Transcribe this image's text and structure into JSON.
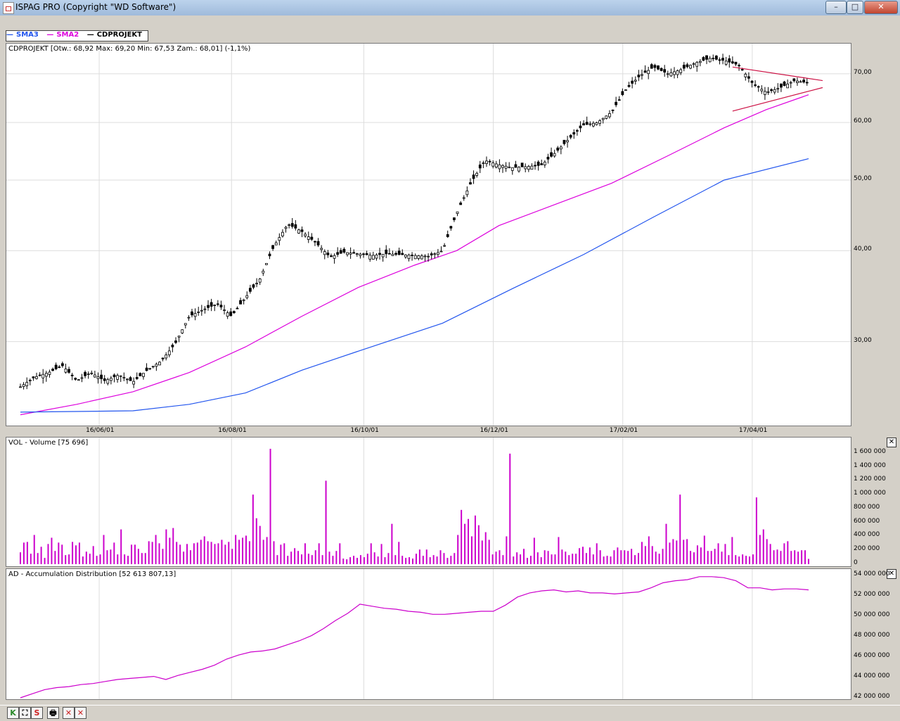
{
  "window": {
    "title": "ISPAG PRO (Copyright \"WD Software\")",
    "min": "–",
    "max": "□",
    "close": "✕"
  },
  "legend": [
    {
      "label": "SMA3",
      "color": "#2255ee"
    },
    {
      "label": "SMA2",
      "color": "#dd00dd"
    },
    {
      "label": "CDPROJEKT",
      "color": "#000000"
    }
  ],
  "price": {
    "info": "CDPROJEKT [Otw.: 68,92  Max: 69,20  Min: 67,53  Zam.: 68,01] (-1,1%)",
    "yticks": [
      "70,00",
      "60,00",
      "50,00",
      "40,00",
      "30,00"
    ],
    "xticks": [
      "16/06/01",
      "16/08/01",
      "16/10/01",
      "16/12/01",
      "17/02/01",
      "17/04/01"
    ]
  },
  "volume": {
    "info": "VOL - Volume [75 696]",
    "yticks": [
      "1 600 000",
      "1 400 000",
      "1 200 000",
      "1 000 000",
      "800 000",
      "600 000",
      "400 000",
      "200 000",
      "0"
    ]
  },
  "ad": {
    "info": "AD - Accumulation Distribution [52 613 807,13]",
    "yticks": [
      "54 000 000",
      "52 000 000",
      "50 000 000",
      "48 000 000",
      "46 000 000",
      "44 000 000",
      "42 000 000"
    ]
  },
  "chart_data": [
    {
      "type": "line",
      "title": "CDPROJEKT",
      "x_range": [
        "16/05/01",
        "17/05/20"
      ],
      "ylim": [
        23,
        77
      ],
      "scale": "log",
      "series": [
        {
          "name": "CDPROJEKT",
          "points": [
            [
              0,
              26
            ],
            [
              5,
              26.8
            ],
            [
              10,
              27.2
            ],
            [
              15,
              27.8
            ],
            [
              20,
              26.5
            ],
            [
              25,
              27.2
            ],
            [
              30,
              26.5
            ],
            [
              35,
              27
            ],
            [
              40,
              26.4
            ],
            [
              45,
              27.4
            ],
            [
              50,
              28.2
            ],
            [
              55,
              29.8
            ],
            [
              60,
              32.5
            ],
            [
              65,
              33.2
            ],
            [
              70,
              33.8
            ],
            [
              75,
              32.5
            ],
            [
              80,
              34.5
            ],
            [
              85,
              36.5
            ],
            [
              90,
              40.5
            ],
            [
              95,
              43.5
            ],
            [
              100,
              42.5
            ],
            [
              105,
              41
            ],
            [
              110,
              39.2
            ],
            [
              115,
              39.8
            ],
            [
              120,
              39.6
            ],
            [
              125,
              39.4
            ],
            [
              130,
              39.6
            ],
            [
              135,
              39.5
            ],
            [
              140,
              39.4
            ],
            [
              145,
              39.3
            ],
            [
              150,
              40
            ],
            [
              155,
              45
            ],
            [
              160,
              49.5
            ],
            [
              165,
              53.2
            ],
            [
              170,
              52.5
            ],
            [
              175,
              52
            ],
            [
              180,
              52.2
            ],
            [
              185,
              52.4
            ],
            [
              190,
              54.5
            ],
            [
              195,
              57
            ],
            [
              200,
              59.5
            ],
            [
              205,
              60
            ],
            [
              210,
              62
            ],
            [
              215,
              66.5
            ],
            [
              220,
              69.5
            ],
            [
              225,
              71.5
            ],
            [
              230,
              70
            ],
            [
              235,
              71
            ],
            [
              240,
              72.5
            ],
            [
              245,
              73.5
            ],
            [
              250,
              73
            ],
            [
              255,
              72
            ],
            [
              260,
              68
            ],
            [
              265,
              66
            ],
            [
              270,
              67
            ],
            [
              275,
              68.5
            ],
            [
              280,
              68
            ]
          ]
        },
        {
          "name": "SMA2",
          "points": [
            [
              0,
              23.8
            ],
            [
              20,
              24.6
            ],
            [
              40,
              25.6
            ],
            [
              60,
              27.2
            ],
            [
              80,
              29.5
            ],
            [
              100,
              32.5
            ],
            [
              120,
              35.6
            ],
            [
              140,
              38.2
            ],
            [
              155,
              40
            ],
            [
              170,
              43.3
            ],
            [
              190,
              46.3
            ],
            [
              210,
              49.5
            ],
            [
              230,
              54
            ],
            [
              250,
              59
            ],
            [
              265,
              62.5
            ],
            [
              280,
              65.5
            ]
          ]
        },
        {
          "name": "SMA3",
          "points": [
            [
              0,
              24
            ],
            [
              40,
              24.1
            ],
            [
              60,
              24.6
            ],
            [
              80,
              25.5
            ],
            [
              100,
              27.4
            ],
            [
              120,
              29.1
            ],
            [
              150,
              31.8
            ],
            [
              175,
              35.5
            ],
            [
              200,
              39.5
            ],
            [
              225,
              44.5
            ],
            [
              250,
              50
            ],
            [
              280,
              53.5
            ]
          ]
        }
      ],
      "trendlines": [
        {
          "from": [
            253,
            71.5
          ],
          "to": [
            285,
            68.5
          ]
        },
        {
          "from": [
            253,
            62.2
          ],
          "to": [
            285,
            67
          ]
        }
      ]
    },
    {
      "type": "bar",
      "title": "VOL - Volume",
      "ylim": [
        0,
        1700000
      ],
      "values": [
        170000,
        310000,
        320000,
        150000,
        420000,
        160000,
        250000,
        90000,
        290000,
        380000,
        190000,
        310000,
        280000,
        130000,
        140000,
        320000,
        270000,
        310000,
        110000,
        180000,
        150000,
        260000,
        120000,
        140000,
        420000,
        200000,
        210000,
        310000,
        140000,
        500000,
        140000,
        120000,
        280000,
        280000,
        220000,
        160000,
        160000,
        330000,
        320000,
        420000,
        300000,
        220000,
        500000,
        380000,
        520000,
        320000,
        280000,
        180000,
        290000,
        200000,
        300000,
        310000,
        350000,
        400000,
        330000,
        320000,
        290000,
        300000,
        350000,
        280000,
        320000,
        220000,
        420000,
        350000,
        380000,
        410000,
        330000,
        1000000,
        660000,
        550000,
        350000,
        390000,
        1660000,
        330000,
        130000,
        280000,
        300000,
        120000,
        180000,
        230000,
        190000,
        140000,
        300000,
        150000,
        130000,
        200000,
        300000,
        130000,
        1200000,
        180000,
        120000,
        190000,
        300000,
        80000,
        70000,
        100000,
        120000,
        90000,
        130000,
        100000,
        150000,
        300000,
        170000,
        110000,
        290000,
        100000,
        160000,
        580000,
        130000,
        320000,
        120000,
        90000,
        100000,
        80000,
        150000,
        210000,
        120000,
        210000,
        100000,
        130000,
        110000,
        200000,
        160000,
        90000,
        120000,
        160000,
        420000,
        780000,
        580000,
        650000,
        400000,
        700000,
        560000,
        340000,
        460000,
        350000,
        140000,
        180000,
        200000,
        130000,
        400000,
        1590000,
        110000,
        170000,
        140000,
        220000,
        90000,
        120000,
        380000,
        170000,
        100000,
        200000,
        190000,
        140000,
        140000,
        390000,
        210000,
        180000,
        130000,
        150000,
        150000,
        230000,
        250000,
        160000,
        240000,
        140000,
        300000,
        200000,
        110000,
        120000,
        110000,
        200000,
        240000,
        200000,
        200000,
        190000,
        220000,
        130000,
        160000,
        320000,
        260000,
        400000,
        260000,
        180000,
        150000,
        220000,
        580000,
        310000,
        360000,
        340000,
        1000000,
        350000,
        360000,
        190000,
        170000,
        270000,
        240000,
        410000,
        190000,
        190000,
        220000,
        300000,
        180000,
        290000,
        130000,
        390000,
        130000,
        110000,
        140000,
        120000,
        110000,
        140000,
        960000,
        420000,
        500000,
        360000,
        290000,
        200000,
        210000,
        190000,
        300000,
        330000,
        190000,
        200000,
        180000,
        200000,
        200000,
        75696
      ]
    },
    {
      "type": "line",
      "title": "AD - Accumulation Distribution",
      "ylim": [
        42000000,
        54300000
      ],
      "values": [
        42000000,
        42400000,
        42800000,
        43000000,
        43100000,
        43300000,
        43400000,
        43600000,
        43800000,
        43900000,
        44000000,
        44100000,
        43800000,
        44200000,
        44500000,
        44800000,
        45200000,
        45800000,
        46200000,
        46500000,
        46600000,
        46800000,
        47200000,
        47600000,
        48100000,
        48800000,
        49600000,
        50300000,
        51200000,
        51000000,
        50800000,
        50700000,
        50500000,
        50400000,
        50200000,
        50200000,
        50300000,
        50400000,
        50500000,
        50500000,
        51100000,
        51900000,
        52300000,
        52500000,
        52600000,
        52400000,
        52500000,
        52300000,
        52300000,
        52200000,
        52300000,
        52400000,
        52800000,
        53300000,
        53500000,
        53600000,
        53900000,
        53900000,
        53800000,
        53500000,
        52800000,
        52800000,
        52600000,
        52700000,
        52700000,
        52600000
      ]
    }
  ],
  "toolbar": {
    "buttons": [
      {
        "label": "K",
        "color": "#2a8a2a"
      },
      {
        "label": "⛶",
        "color": "#333"
      },
      {
        "label": "S",
        "color": "#cc2222"
      },
      {
        "label": "🖶",
        "color": "#225"
      },
      {
        "label": "✕",
        "color": "#cc2222"
      },
      {
        "label": "✕",
        "color": "#cc2222"
      }
    ]
  }
}
